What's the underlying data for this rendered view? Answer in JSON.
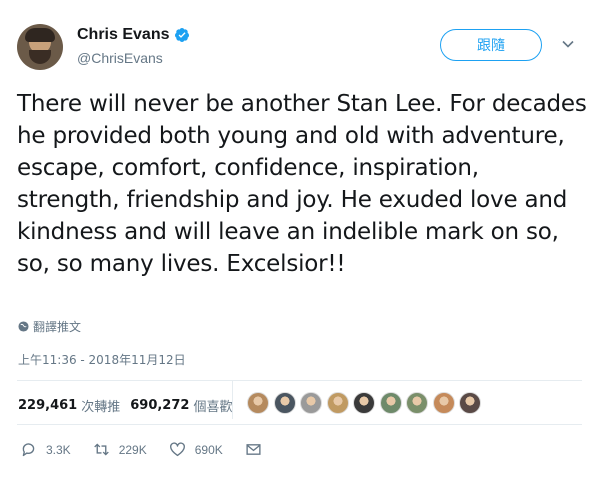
{
  "header": {
    "display_name": "Chris Evans",
    "handle": "@ChrisEvans",
    "follow_label": "跟隨"
  },
  "tweet": {
    "text": "There will never be another Stan Lee. For decades he provided both young and old with adventure, escape, comfort, confidence, inspiration, strength, friendship and joy. He exuded love and kindness and will leave an indelible mark on so, so, so many lives. Excelsior!!",
    "translate_label": "翻譯推文",
    "timestamp": "上午11:36 - 2018年11月12日"
  },
  "stats": {
    "retweets_count": "229,461",
    "retweets_label": "次轉推",
    "likes_count": "690,272",
    "likes_label": "個喜歡"
  },
  "liker_avatars": [
    {
      "color": "#b58a5e"
    },
    {
      "color": "#4a5560"
    },
    {
      "color": "#9a9a9a"
    },
    {
      "color": "#c09a62"
    },
    {
      "color": "#3a3a3a"
    },
    {
      "color": "#6e8a6a"
    },
    {
      "color": "#7a8f6a"
    },
    {
      "color": "#c58a5a"
    },
    {
      "color": "#5a4a46"
    }
  ],
  "actions": {
    "reply_count": "3.3K",
    "retweet_count": "229K",
    "like_count": "690K"
  },
  "colors": {
    "accent": "#1da1f2",
    "muted": "#657786"
  }
}
